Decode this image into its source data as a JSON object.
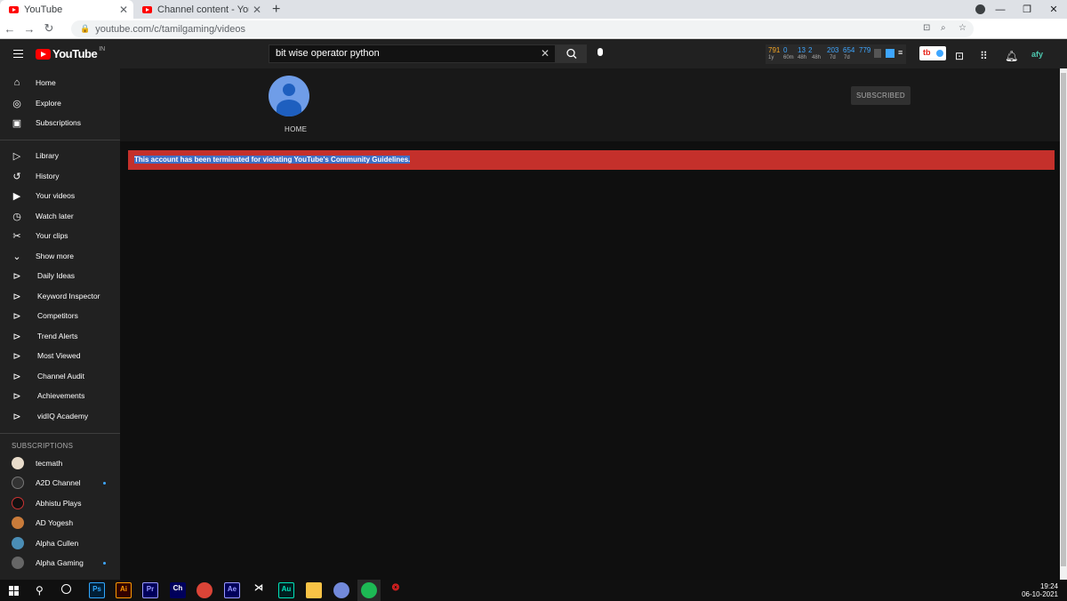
{
  "browser": {
    "tabs": [
      {
        "title": "YouTube",
        "active": true
      },
      {
        "title": "Channel content - YouTube Studio",
        "active": false
      }
    ],
    "url": "youtube.com/c/tamilgaming/videos"
  },
  "header": {
    "logo_text": "YouTube",
    "region": "IN",
    "search_value": "bit wise operator python"
  },
  "vidiq_stats": {
    "views": "791",
    "v1": "0",
    "v2": "13",
    "v3": "2",
    "v4": "203",
    "v5": "654",
    "v6": "779",
    "s1": "1y",
    "s2": "60m",
    "s3": "48h",
    "s4": "48h",
    "s5": "7d",
    "s6": "7d"
  },
  "sidebar": {
    "main": [
      "Home",
      "Explore",
      "Subscriptions"
    ],
    "library": [
      "Library",
      "History",
      "Your videos",
      "Watch later",
      "Your clips",
      "Show more"
    ],
    "vidiq": [
      "Daily Ideas",
      "Keyword Inspector",
      "Competitors",
      "Trend Alerts",
      "Most Viewed",
      "Channel Audit",
      "Achievements",
      "vidIQ Academy"
    ],
    "subscriptions_header": "SUBSCRIPTIONS",
    "subscriptions": [
      "tecmath",
      "A2D Channel",
      "Abhistu Plays",
      "AD Yogesh",
      "Alpha Cullen",
      "Alpha Gaming"
    ]
  },
  "channel": {
    "tab": "HOME",
    "subscribe_label": "SUBSCRIBED",
    "alert": "This account has been terminated for violating YouTube's Community Guidelines."
  },
  "taskbar": {
    "apps": [
      "Ps",
      "Ai",
      "Pr",
      "Ch",
      "Ae",
      "Au"
    ],
    "time": "19:24",
    "date": "06-10-2021"
  },
  "colors": {
    "youtube_red": "#ff0000",
    "alert_red": "#c4302b",
    "link_blue": "#3ea6ff"
  }
}
